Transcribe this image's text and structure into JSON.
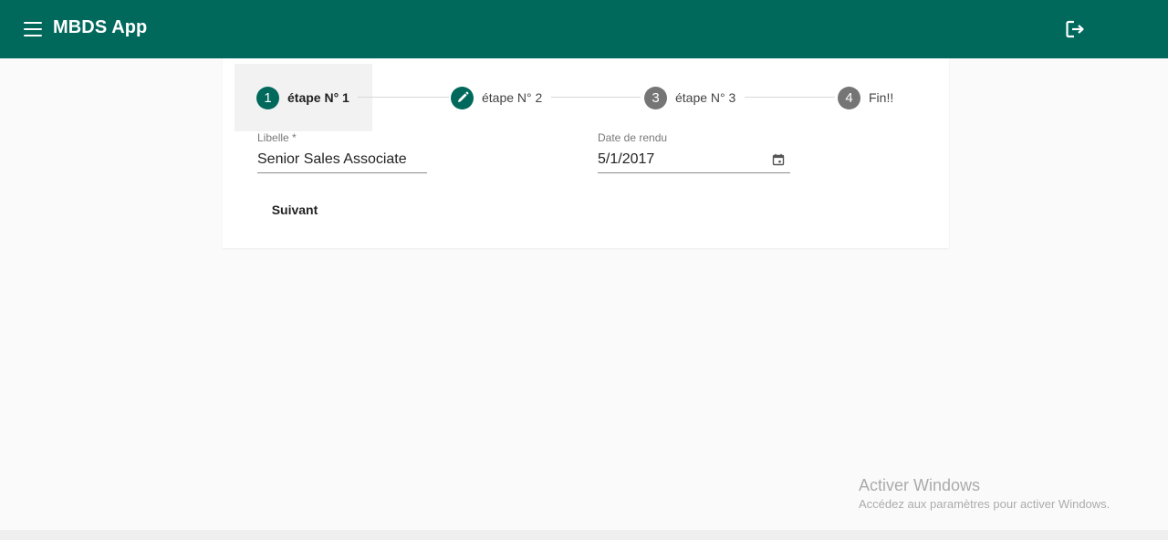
{
  "colors": {
    "primary": "#00695c",
    "inactive_step": "#757575",
    "background": "#fafafa"
  },
  "toolbar": {
    "title": "MBDS App",
    "menu_icon": "menu-icon",
    "logout_icon": "logout-icon"
  },
  "stepper": {
    "steps": [
      {
        "number": "1",
        "label": "étape N° 1",
        "state": "active",
        "icon": ""
      },
      {
        "number": "",
        "label": "étape N° 2",
        "state": "edit",
        "icon": "pencil-icon"
      },
      {
        "number": "3",
        "label": "étape N° 3",
        "state": "inactive",
        "icon": ""
      },
      {
        "number": "4",
        "label": "Fin!!",
        "state": "inactive",
        "icon": ""
      }
    ]
  },
  "form": {
    "libelle": {
      "label": "Libelle *",
      "value": "Senior Sales Associate"
    },
    "date_rendu": {
      "label": "Date de rendu",
      "value": "5/1/2017",
      "icon": "calendar-icon"
    },
    "next_label": "Suivant"
  },
  "watermark": {
    "title": "Activer Windows",
    "subtitle": "Accédez aux paramètres pour activer Windows."
  }
}
